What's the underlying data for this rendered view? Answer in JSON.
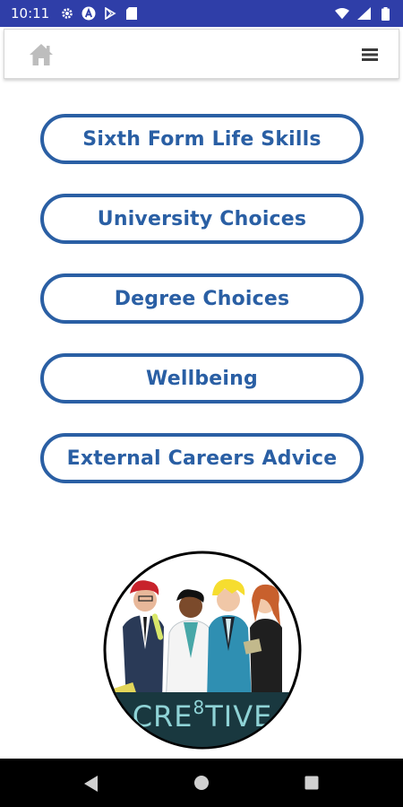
{
  "status_bar": {
    "time": "10:11",
    "icons_left": [
      "settings-icon",
      "a-circle-icon",
      "play-store-icon",
      "sd-card-icon"
    ],
    "icons_right": [
      "wifi-icon",
      "signal-icon",
      "battery-icon"
    ],
    "background": "#2f3ea8"
  },
  "app_bar": {
    "home_icon": "home-icon",
    "menu_icon": "hamburger-menu-icon"
  },
  "menu": {
    "items": [
      {
        "label": "Sixth Form Life Skills"
      },
      {
        "label": "University Choices"
      },
      {
        "label": "Degree Choices"
      },
      {
        "label": "Wellbeing"
      },
      {
        "label": "External Careers Advice"
      }
    ],
    "accent": "#2a5fa4"
  },
  "logo": {
    "text_pre": "CRE",
    "text_sup": "8",
    "text_post": "TIVE",
    "text_color": "#8fd3d6",
    "band_color": "#19383f"
  },
  "system_nav": {
    "icons": [
      "back-icon",
      "home-circle-icon",
      "recents-icon"
    ]
  }
}
